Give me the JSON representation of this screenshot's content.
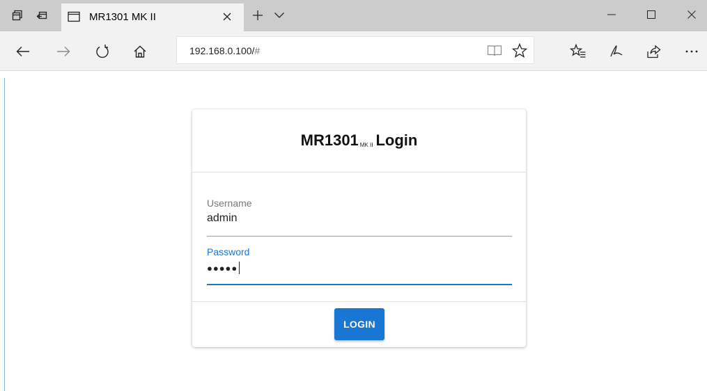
{
  "browser": {
    "tab": {
      "title": "MR1301 MK II"
    },
    "address": {
      "url_main": "192.168.0.100/",
      "url_hash": "#"
    }
  },
  "login": {
    "title_main": "MR1301",
    "title_sub": "MK II",
    "title_suffix": "Login",
    "username_label": "Username",
    "username_value": "admin",
    "password_label": "Password",
    "password_value": "●●●●●",
    "submit_label": "LOGIN"
  },
  "colors": {
    "accent": "#1976d2",
    "tabstrip": "#cccccc",
    "navbar": "#f2f2f2"
  }
}
